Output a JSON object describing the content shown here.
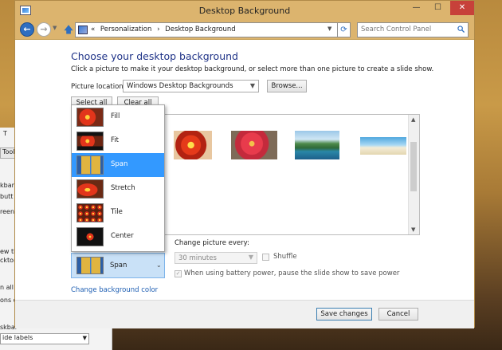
{
  "window": {
    "title": "Desktop Background",
    "min": "—",
    "max": "☐",
    "close": "✕"
  },
  "nav": {
    "breadcrumb_prefix": "«",
    "crumb1": "Personalization",
    "sep": "›",
    "crumb2": "Desktop Background",
    "search_placeholder": "Search Control Panel"
  },
  "page": {
    "heading": "Choose your desktop background",
    "subheading": "Click a picture to make it your desktop background, or select more than one picture to create a slide show.",
    "location_label": "Picture location:",
    "location_value": "Windows Desktop Backgrounds",
    "browse": "Browse...",
    "select_all": "Select all",
    "clear_all": "Clear all"
  },
  "position_menu": {
    "items": [
      "Fill",
      "Fit",
      "Span",
      "Stretch",
      "Tile",
      "Center"
    ],
    "selected": "Span"
  },
  "position_combo": {
    "value": "Span"
  },
  "slideshow": {
    "change_label": "Change picture every:",
    "interval": "30 minutes",
    "shuffle": "Shuffle",
    "battery": "When using battery power, pause the slide show to save power"
  },
  "change_bg_color": "Change background color",
  "footer": {
    "save": "Save changes",
    "cancel": "Cancel"
  },
  "background_window": {
    "t1": "T",
    "tools": "Tool",
    "lines": [
      "kbar",
      "butt",
      "reen",
      "ew th",
      "ckton a",
      "n all a",
      "ons o",
      "skbar"
    ],
    "bottom_select": "ide labels"
  },
  "colors": {
    "accent": "#3399ff",
    "heading": "#1e3287",
    "link": "#1f5fb3",
    "frame": "#dcb46e"
  }
}
